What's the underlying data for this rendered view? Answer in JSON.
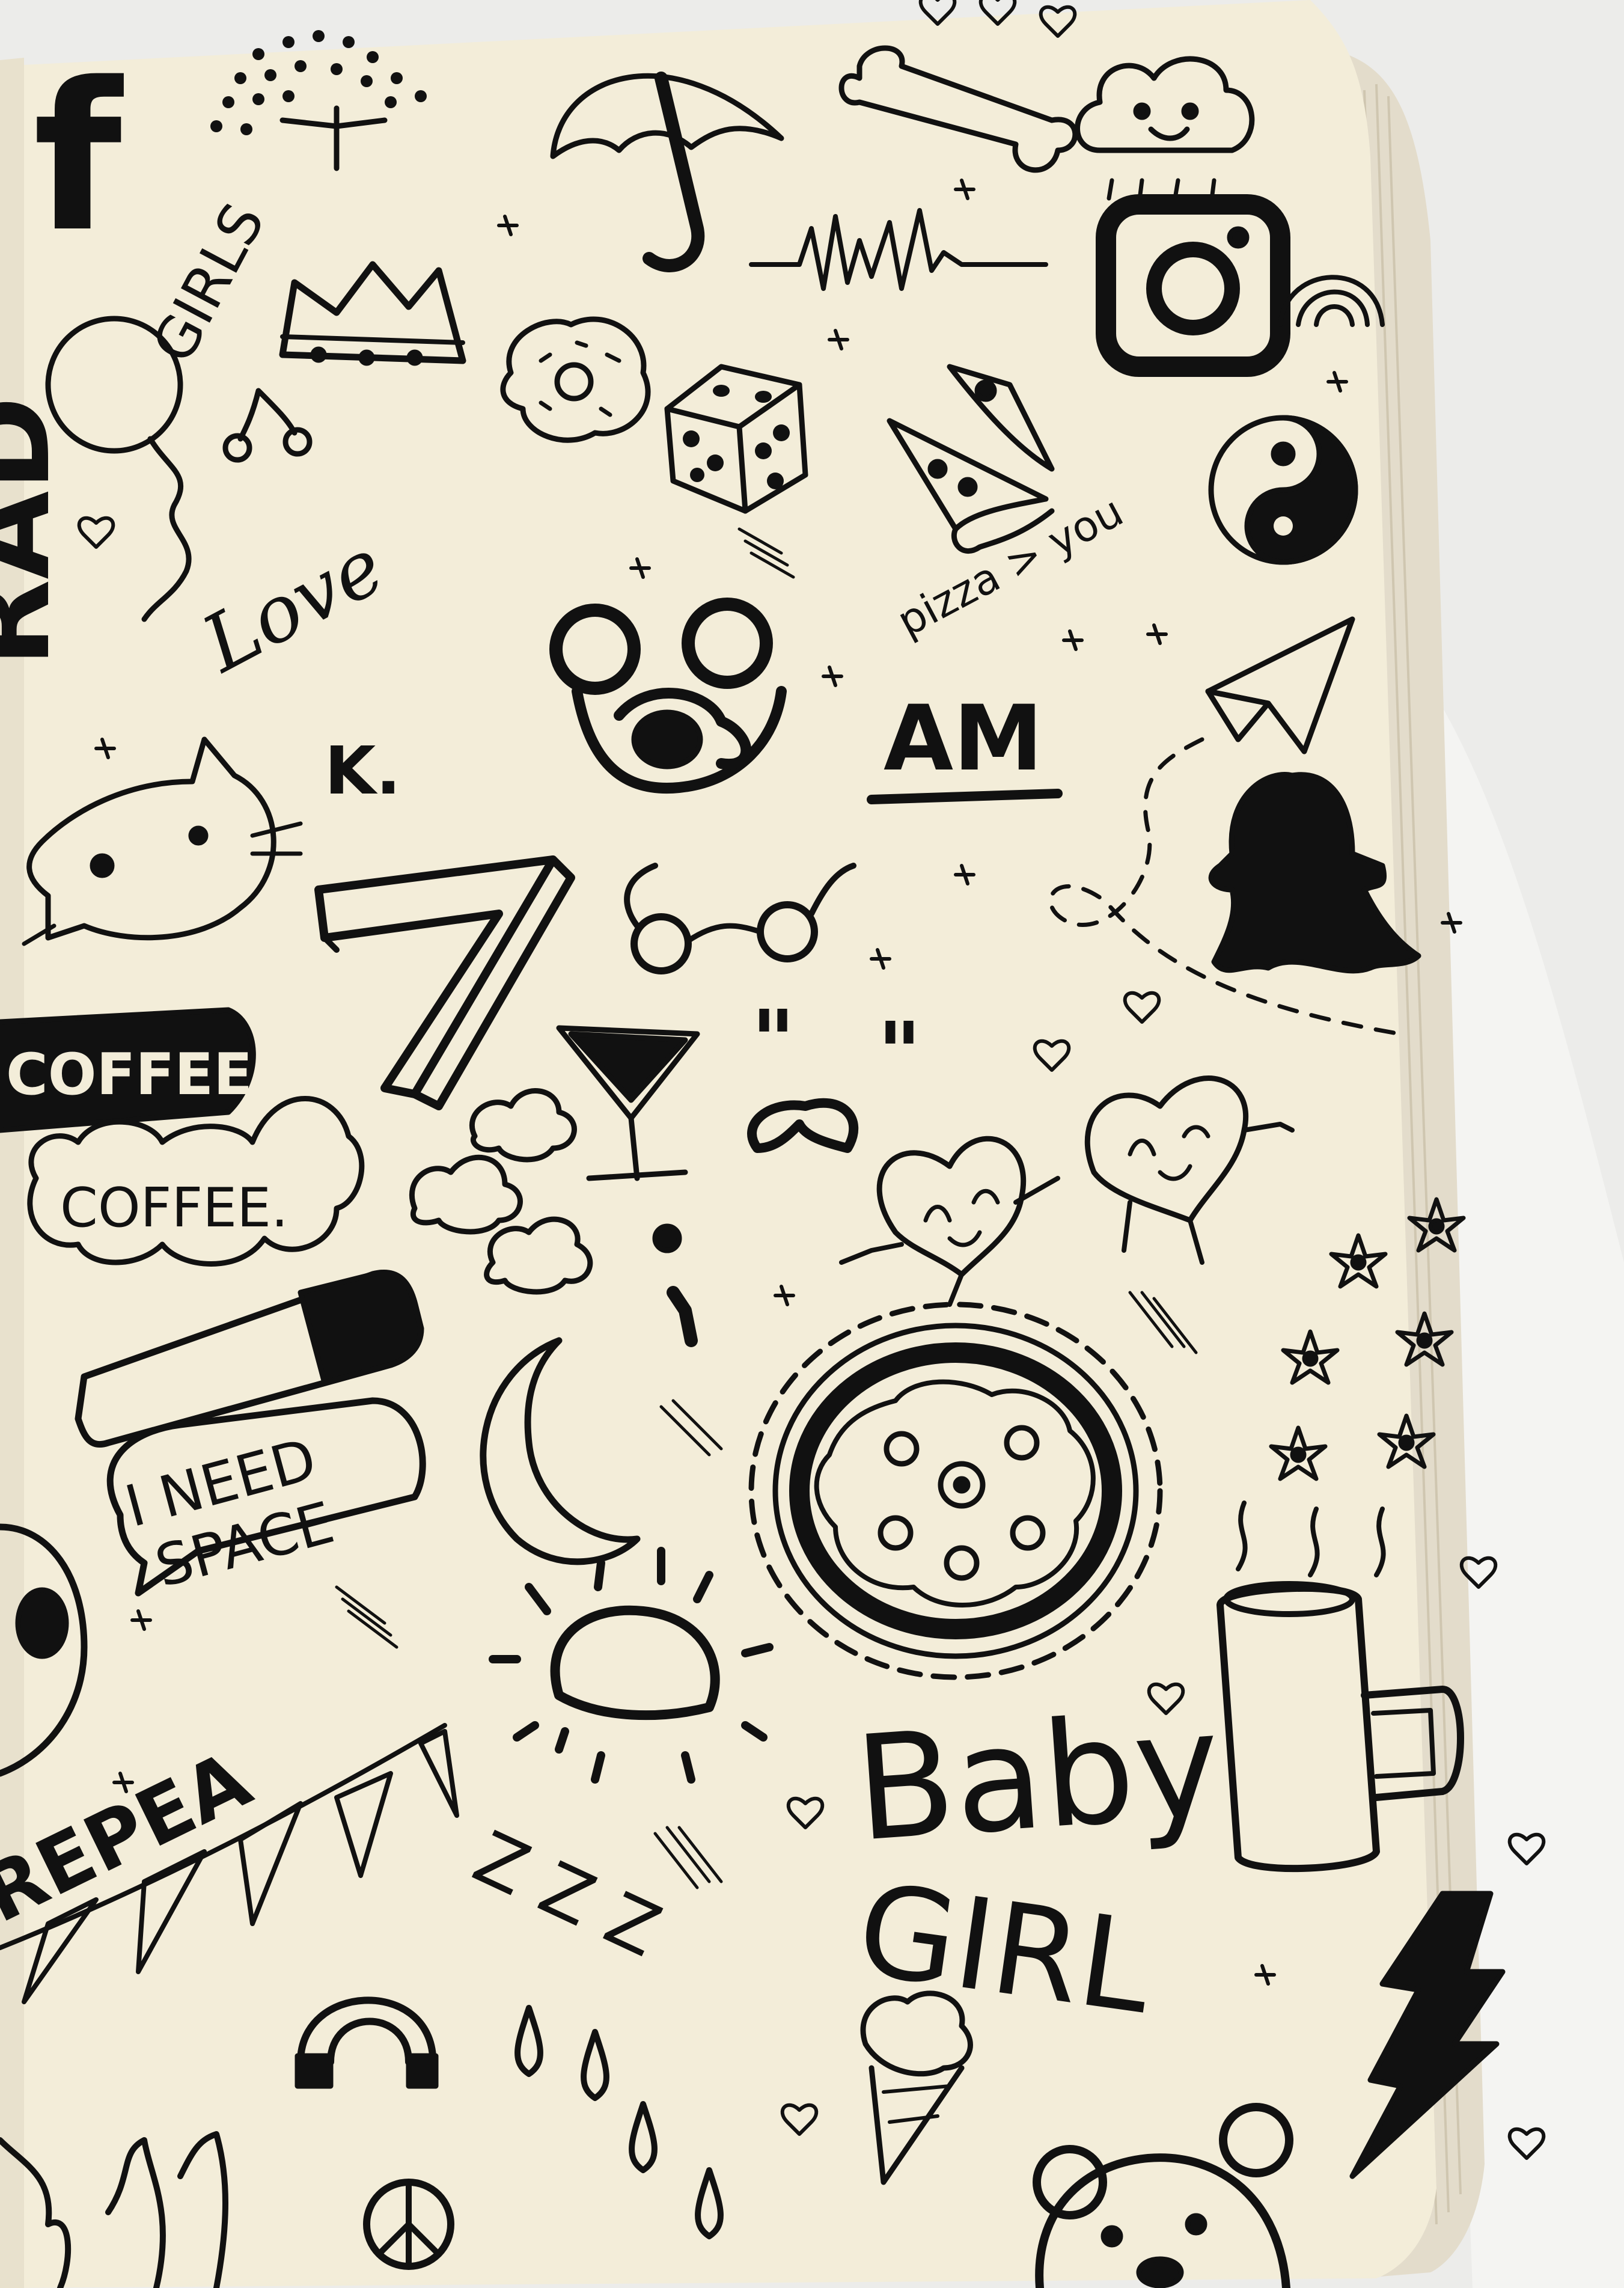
{
  "photo": {
    "subject": "sketchbook page with black ink doodles",
    "colors": {
      "paper": "#f3edd9",
      "ink": "#111111",
      "background_cloth": "#ececea",
      "page_edges": "#e6dfcb"
    }
  },
  "doodle_text": {
    "facebook_letter": "f",
    "girls": "GIRLS",
    "love": "Love",
    "k_initial": "K.",
    "am": "AM",
    "pizza_gt_you": "pizza > you",
    "seven": "7",
    "coffee_question": "COFFEE?",
    "coffee_period": "COFFEE.",
    "i_need": "I NEED",
    "space": "SPACE",
    "baby": "Baby",
    "girl": "GIRL",
    "repeat": "REPEA",
    "zzz": "Z Z Z",
    "rad": "RAD"
  },
  "icons": [
    "facebook-logo-icon",
    "tree-icon",
    "umbrella-icon",
    "bone-icon",
    "cloud-face-icon",
    "heartbeat-line-icon",
    "instagram-logo-icon",
    "rainbow-icon",
    "crown-icon",
    "balloon-icon",
    "cherries-icon",
    "donut-icon",
    "dice-icon",
    "pizza-slice-icon",
    "yin-yang-icon",
    "jake-the-dog-icon",
    "paper-plane-icon",
    "cat-face-icon",
    "snapchat-ghost-icon",
    "glasses-icon",
    "martini-glass-icon",
    "heart-characters-icon",
    "battery-icon",
    "moon-icon",
    "pizza-icon",
    "sun-icon",
    "flowers-icon",
    "coffee-mug-icon",
    "bunting-flags-icon",
    "lightning-bolt-icon",
    "ice-cream-cone-icon",
    "peace-sign-icon",
    "bear-face-icon",
    "raindrops-icon",
    "magnet-icon"
  ]
}
